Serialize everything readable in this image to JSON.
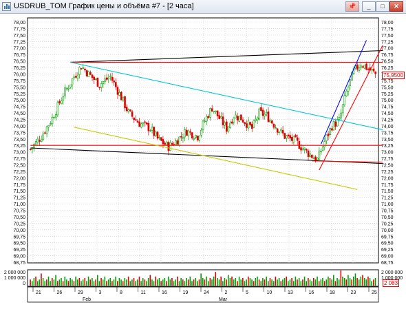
{
  "window": {
    "title": "USDRUB_TOM График цены и объёма #7 - [2 часа]",
    "buttons": {
      "minimize": "_",
      "maximize": "□",
      "close": "✕"
    },
    "pin_icon": "pin-icon"
  },
  "price_axis": {
    "min": 68.75,
    "max": 78.0,
    "step": 0.25,
    "labels": [
      "78,00",
      "77,75",
      "77,50",
      "77,25",
      "77,00",
      "76,75",
      "76,50",
      "76,25",
      "76,00",
      "75,75",
      "75,50",
      "75,25",
      "75,00",
      "74,75",
      "74,50",
      "74,25",
      "74,00",
      "73,75",
      "73,50",
      "73,25",
      "73,00",
      "72,75",
      "72,50",
      "72,25",
      "72,00",
      "71,75",
      "71,50",
      "71,25",
      "71,00",
      "70,75",
      "70,50",
      "70,25",
      "70,00",
      "69,75",
      "69,50",
      "69,25",
      "69,00",
      "68,75"
    ]
  },
  "current_price": "75,9500",
  "volume_axis": {
    "labels": [
      "2 000 000",
      "1 000 000",
      "0"
    ],
    "max": 2000000
  },
  "current_volume": "2 083",
  "date_axis": {
    "days": [
      "21",
      "26",
      "29",
      "3",
      "8",
      "11",
      "16",
      "19",
      "24",
      "2",
      "5",
      "10",
      "13",
      "16",
      "18",
      "23",
      "25"
    ],
    "months": [
      "Feb",
      "Mar"
    ]
  },
  "colors": {
    "candle_up": "#00a000",
    "candle_down": "#e00000",
    "grid": "#c8c8c8",
    "red_line": "#ff0000",
    "black_line": "#000000",
    "cyan_line": "#00c8d8",
    "yellow_line": "#c8c800",
    "blue_line": "#0000ff",
    "titlebar": "#dfe6f0"
  },
  "chart_data": {
    "type": "candlestick",
    "instrument": "USDRUB_TOM",
    "timeframe": "2 часа",
    "ylim": [
      68.75,
      78.0
    ],
    "close_path": [
      [
        0,
        73.1
      ],
      [
        6,
        73.6
      ],
      [
        12,
        74.3
      ],
      [
        18,
        75.2
      ],
      [
        24,
        75.9
      ],
      [
        28,
        76.3
      ],
      [
        32,
        76.0
      ],
      [
        38,
        75.6
      ],
      [
        44,
        75.9
      ],
      [
        50,
        75.1
      ],
      [
        54,
        74.5
      ],
      [
        60,
        74.1
      ],
      [
        66,
        73.9
      ],
      [
        70,
        73.5
      ],
      [
        76,
        73.2
      ],
      [
        80,
        73.4
      ],
      [
        86,
        73.8
      ],
      [
        92,
        73.6
      ],
      [
        96,
        74.2
      ],
      [
        100,
        74.7
      ],
      [
        104,
        74.3
      ],
      [
        108,
        73.9
      ],
      [
        112,
        74.4
      ],
      [
        116,
        74.3
      ],
      [
        122,
        73.9
      ],
      [
        126,
        74.5
      ],
      [
        130,
        74.4
      ],
      [
        136,
        73.9
      ],
      [
        140,
        73.6
      ],
      [
        146,
        73.4
      ],
      [
        152,
        73.0
      ],
      [
        156,
        72.8
      ],
      [
        158,
        72.7
      ],
      [
        162,
        73.4
      ],
      [
        166,
        74.0
      ],
      [
        170,
        74.2
      ],
      [
        174,
        75.3
      ],
      [
        178,
        76.1
      ],
      [
        182,
        76.4
      ],
      [
        186,
        76.2
      ],
      [
        190,
        76.0
      ],
      [
        194,
        76.0
      ]
    ],
    "volumes": [
      0.4,
      0.3,
      0.5,
      0.6,
      0.3,
      0.4,
      0.8,
      0.5,
      0.3,
      0.4,
      0.6,
      0.3,
      0.5,
      0.4,
      0.7,
      0.3,
      0.4,
      0.5,
      0.3,
      0.6,
      0.4,
      0.3,
      0.5,
      0.4,
      0.3,
      0.6,
      0.4,
      0.5,
      0.3,
      0.4,
      0.5,
      0.3,
      0.6,
      0.4,
      0.5,
      0.3,
      0.4,
      0.7,
      0.3,
      0.5,
      0.4,
      0.6,
      0.3,
      0.4,
      0.5,
      0.3,
      0.4,
      0.6,
      0.3,
      0.5,
      0.4,
      0.3,
      0.5,
      0.4,
      0.6,
      0.3,
      0.4,
      0.5,
      0.3,
      0.4,
      0.6,
      0.3,
      0.5,
      0.4,
      0.3,
      0.5,
      0.7,
      0.4,
      0.3,
      0.6,
      0.4,
      0.5,
      0.3,
      0.4,
      0.5,
      0.3,
      0.6,
      0.4,
      0.5,
      0.3,
      0.4,
      0.6,
      0.3,
      0.5,
      0.4,
      0.3,
      0.5,
      0.4,
      0.6,
      0.3,
      0.4,
      0.5,
      0.3,
      0.4,
      0.8,
      0.5,
      0.4,
      0.6,
      0.3,
      0.5,
      0.4,
      0.6,
      0.9,
      0.5,
      0.4,
      0.6,
      0.3,
      0.5,
      0.4,
      0.7,
      0.5,
      0.6,
      0.4,
      0.5,
      0.3,
      0.6,
      0.4,
      0.5,
      0.3,
      0.4,
      0.6,
      0.5,
      0.4,
      0.3,
      0.5,
      0.6,
      0.4,
      0.3,
      0.5,
      0.4,
      0.6,
      0.3,
      0.5,
      0.4,
      0.3,
      0.6,
      0.4,
      0.5,
      0.3,
      0.4,
      0.5,
      0.6,
      0.3,
      0.4,
      0.5,
      0.3,
      0.6,
      0.4,
      0.5,
      0.3,
      0.4,
      0.6,
      0.3,
      0.5,
      0.4,
      0.3,
      0.5,
      0.4,
      0.6,
      0.3,
      0.4,
      0.5,
      0.3,
      0.4,
      0.6,
      0.5,
      0.4,
      0.7,
      0.3,
      0.5,
      0.4,
      1.0,
      0.6,
      0.5,
      0.4,
      0.7,
      0.5,
      0.4,
      0.6,
      0.8,
      0.5,
      0.4,
      0.6,
      0.7,
      0.5,
      0.4,
      0.6,
      0.5,
      0.3,
      0.4,
      0.5
    ],
    "trendlines": [
      {
        "color": "black",
        "from": [
          22,
          76.45
        ],
        "to": [
          194,
          76.9
        ]
      },
      {
        "color": "black",
        "from": [
          0,
          73.15
        ],
        "to": [
          194,
          72.55
        ]
      },
      {
        "color": "red",
        "from": [
          22,
          76.45
        ],
        "to": [
          194,
          76.45
        ]
      },
      {
        "color": "red",
        "from": [
          0,
          73.25
        ],
        "to": [
          194,
          73.25
        ]
      },
      {
        "color": "red",
        "from": [
          155,
          72.65
        ],
        "to": [
          194,
          72.6
        ]
      },
      {
        "color": "red",
        "from": [
          159,
          72.3
        ],
        "to": [
          194,
          77.1
        ]
      },
      {
        "color": "cyan",
        "from": [
          22,
          76.45
        ],
        "to": [
          194,
          73.85
        ]
      },
      {
        "color": "yellow",
        "from": [
          24,
          73.95
        ],
        "to": [
          180,
          71.55
        ]
      },
      {
        "color": "blue",
        "from": [
          160,
          73.3
        ],
        "to": [
          185,
          77.3
        ]
      }
    ]
  }
}
